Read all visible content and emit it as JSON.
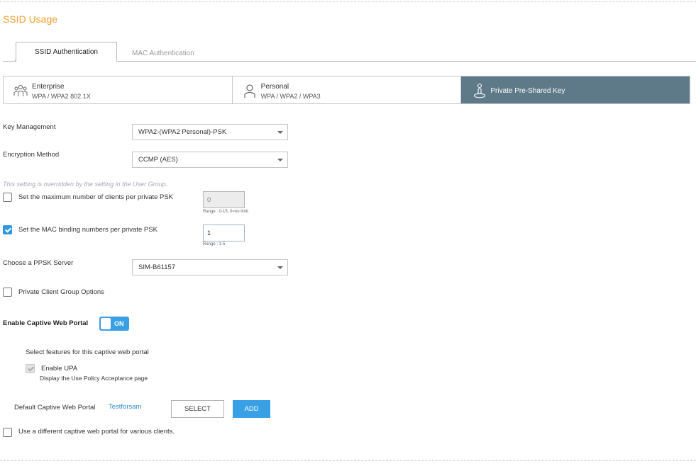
{
  "section_title": "SSID Usage",
  "tabs": [
    {
      "label": "SSID Authentication",
      "active": true
    },
    {
      "label": "MAC Authentication",
      "active": false
    }
  ],
  "auth_types": [
    {
      "name": "Enterprise",
      "sub": "WPA / WPA2 802.1X",
      "icon": "users-icon"
    },
    {
      "name": "Personal",
      "sub": "WPA / WPA2 / WPA3",
      "icon": "user-icon"
    },
    {
      "name": "Private Pre-Shared Key",
      "sub": "",
      "icon": "person-key-icon",
      "active": true
    }
  ],
  "form": {
    "key_management": {
      "label": "Key Management",
      "value": "WPA2-(WPA2 Personal)-PSK"
    },
    "encryption_method": {
      "label": "Encryption Method",
      "value": "CCMP (AES)"
    },
    "override_note": "This setting is overridden by the setting in the User Group.",
    "max_clients": {
      "label": "Set the maximum number of clients per private PSK",
      "value": "0",
      "range": "Range : 0-15, 0=no limit",
      "checked": false
    },
    "mac_binding": {
      "label": "Set the MAC binding numbers per private PSK",
      "value": "1",
      "range": "Range : 1-5",
      "checked": true
    },
    "ppsk_server": {
      "label": "Choose a PPSK Server",
      "value": "SIM-B61157"
    },
    "private_client_group": {
      "label": "Private Client Group Options",
      "checked": false
    },
    "captive_portal": {
      "label": "Enable Captive Web Portal",
      "toggle": "ON",
      "features_label": "Select features for this captive web portal",
      "upa_label": "Enable UPA",
      "upa_desc": "Display the Use Policy Acceptance page",
      "default_label": "Default Captive Web Portal",
      "default_value": "Testforsam",
      "select_btn": "SELECT",
      "add_btn": "ADD",
      "different_portal_label": "Use a different captive web portal for various clients."
    }
  },
  "colors": {
    "accent": "#f0a030",
    "primary": "#3aa0e6",
    "selected_tab": "#5e7a89"
  }
}
